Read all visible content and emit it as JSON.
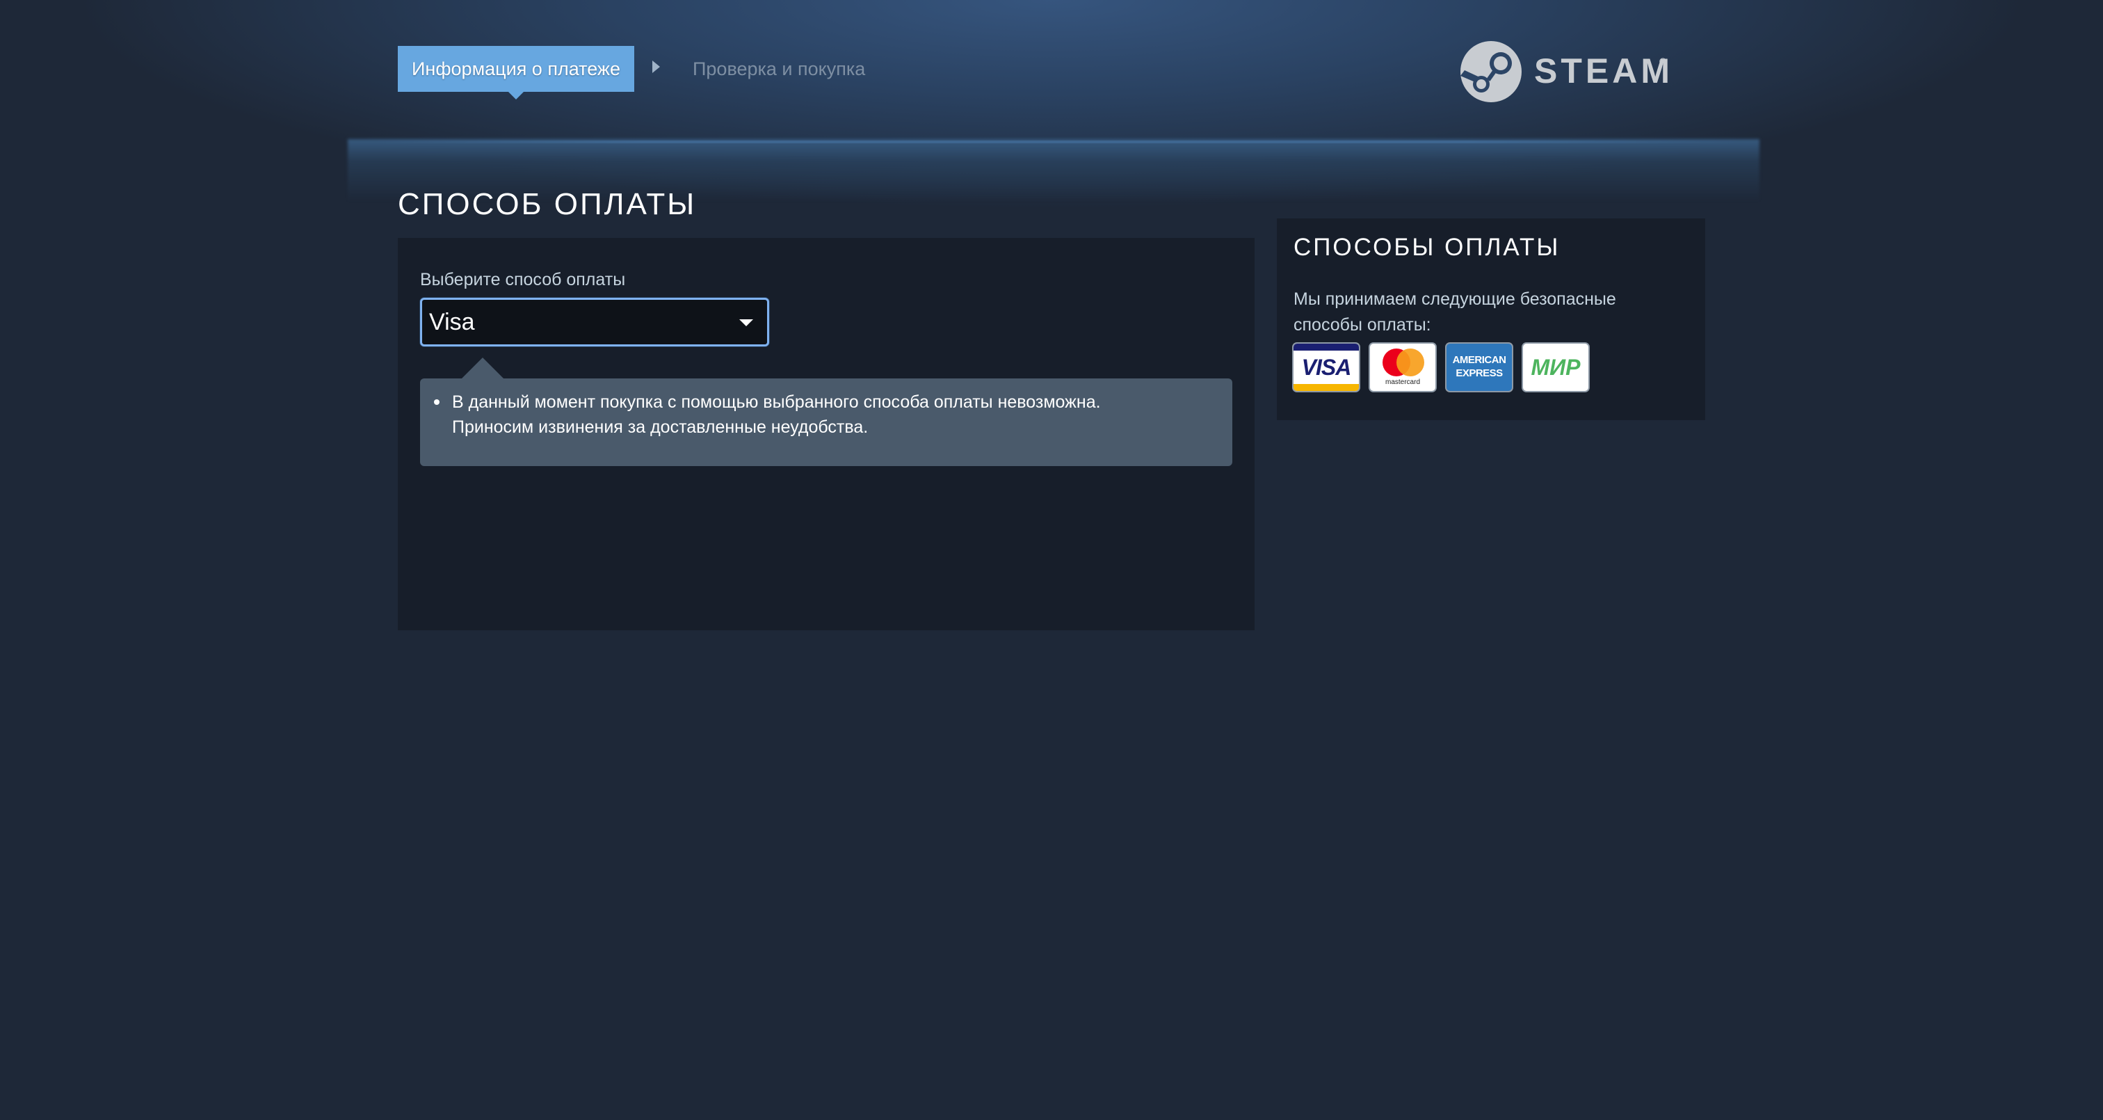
{
  "steps": {
    "active_label": "Информация о платеже",
    "next_label": "Проверка и покупка"
  },
  "brand": {
    "name": "STEAM",
    "registered_mark": "®"
  },
  "main": {
    "title": "СПОСОБ ОПЛАТЫ",
    "select_label": "Выберите способ оплаты",
    "selected_method": "Visa",
    "notice_line1": "В данный момент покупка с помощью выбранного способа оплаты невозможна.",
    "notice_line2": "Приносим извинения за доставленные неудобства."
  },
  "side": {
    "title": "СПОСОБЫ ОПЛАТЫ",
    "text": "Мы принимаем следующие безопасные способы оплаты:",
    "cards": [
      {
        "name": "visa-card-icon",
        "text": "VISA"
      },
      {
        "name": "mastercard-card-icon",
        "text": "mastercard"
      },
      {
        "name": "amex-card-icon",
        "text": "AMERICAN EXPRESS"
      },
      {
        "name": "mir-card-icon",
        "text": "МИР"
      }
    ]
  },
  "colors": {
    "background": "#1e2838",
    "panel": "#171e2a",
    "accent": "#67a7e0",
    "notice": "#4a5a6b",
    "select_border": "#7fb2f0"
  }
}
